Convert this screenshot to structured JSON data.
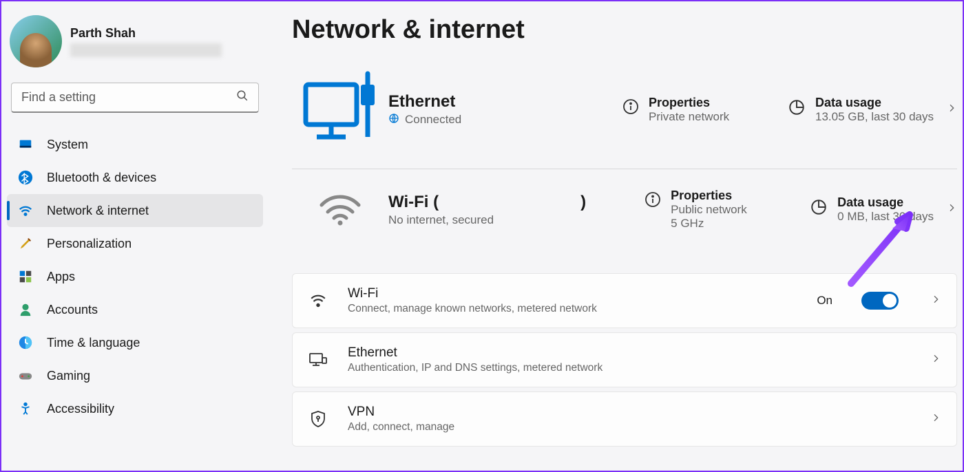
{
  "user": {
    "name": "Parth Shah"
  },
  "search": {
    "placeholder": "Find a setting"
  },
  "nav": [
    {
      "label": "System"
    },
    {
      "label": "Bluetooth & devices"
    },
    {
      "label": "Network & internet"
    },
    {
      "label": "Personalization"
    },
    {
      "label": "Apps"
    },
    {
      "label": "Accounts"
    },
    {
      "label": "Time & language"
    },
    {
      "label": "Gaming"
    },
    {
      "label": "Accessibility"
    }
  ],
  "page": {
    "title": "Network & internet"
  },
  "ethernet": {
    "title": "Ethernet",
    "status": "Connected",
    "props_title": "Properties",
    "props_sub": "Private network",
    "usage_title": "Data usage",
    "usage_sub": "13.05 GB, last 30 days"
  },
  "wifi_conn": {
    "title": "Wi-Fi (",
    "title_end": ")",
    "status": "No internet, secured",
    "props_title": "Properties",
    "props_sub1": "Public network",
    "props_sub2": "5 GHz",
    "usage_title": "Data usage",
    "usage_sub": "0 MB, last 30 days"
  },
  "cards": {
    "wifi": {
      "title": "Wi-Fi",
      "sub": "Connect, manage known networks, metered network",
      "toggle": "On"
    },
    "ethernet": {
      "title": "Ethernet",
      "sub": "Authentication, IP and DNS settings, metered network"
    },
    "vpn": {
      "title": "VPN",
      "sub": "Add, connect, manage"
    }
  }
}
